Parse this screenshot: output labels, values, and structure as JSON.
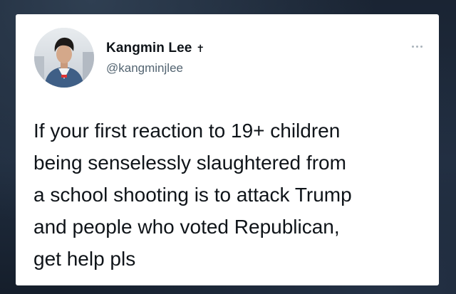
{
  "author": {
    "display_name": "Kangmin Lee",
    "badge_icon": "cross-icon",
    "handle": "@kangminjlee"
  },
  "tweet": {
    "text": "If your first reaction to 19+ children\nbeing senselessly slaughtered from\na school shooting is to attack Trump\nand people who voted Republican,\nget help pls"
  },
  "menu": {
    "icon": "more-options-icon"
  },
  "colors": {
    "card_background": "#ffffff",
    "text_primary": "#0f1419",
    "text_secondary": "#536471",
    "page_background": "#1c2838"
  }
}
